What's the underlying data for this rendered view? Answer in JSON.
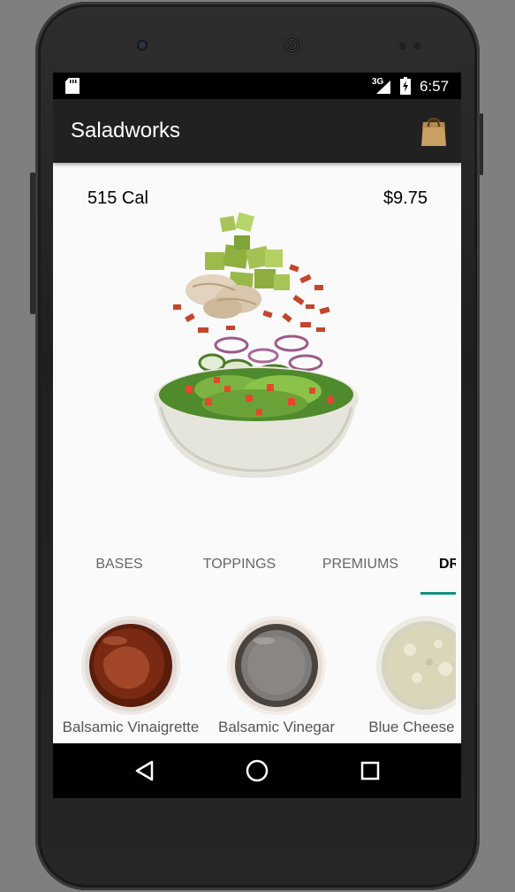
{
  "status_bar": {
    "network": "3G",
    "time": "6:57"
  },
  "app_bar": {
    "title": "Saladworks",
    "cart_icon": "shopping-bag-icon"
  },
  "summary": {
    "calories": "515 Cal",
    "price": "$9.75"
  },
  "tabs": [
    {
      "label": "BASES",
      "active": false
    },
    {
      "label": "TOPPINGS",
      "active": false
    },
    {
      "label": "PREMIUMS",
      "active": false
    },
    {
      "label": "DR",
      "active": true
    }
  ],
  "dressings": [
    {
      "name": "Balsamic Vinaigrette"
    },
    {
      "name": "Balsamic Vinegar"
    },
    {
      "name": "Blue Cheese Dre"
    }
  ],
  "colors": {
    "app_bar": "#212121",
    "accent": "#109282",
    "screen_bg": "#fafafa"
  },
  "nav_bar": {
    "icons": [
      "back-icon",
      "home-icon",
      "recents-icon"
    ]
  }
}
